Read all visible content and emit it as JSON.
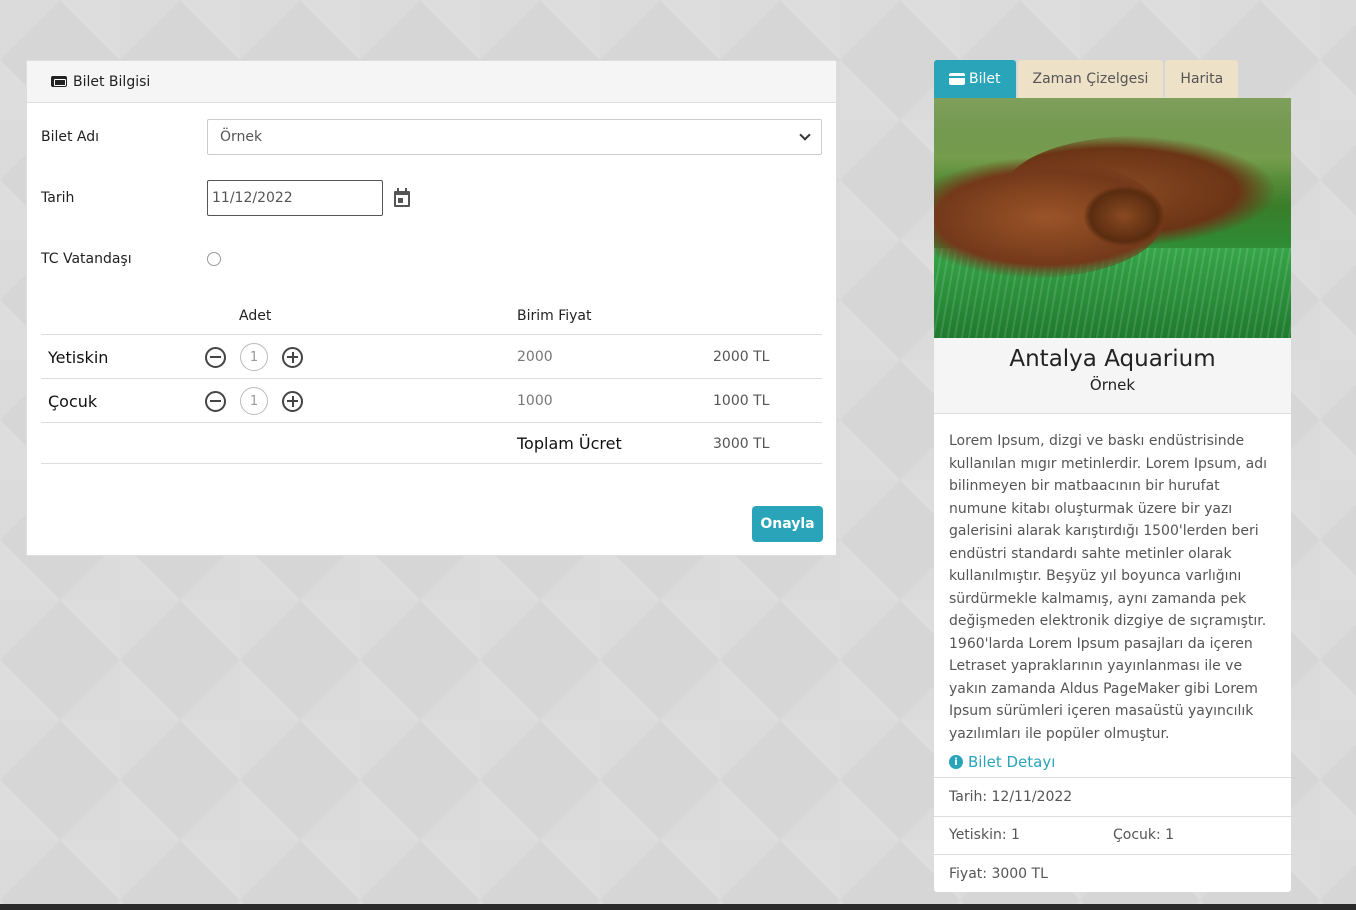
{
  "form": {
    "header_title": "Bilet Bilgisi",
    "ticket_name_label": "Bilet Adı",
    "ticket_name_value": "Örnek",
    "date_label": "Tarih",
    "date_value": "11/12/2022",
    "citizen_label": "TC Vatandaşı",
    "table": {
      "col_qty": "Adet",
      "col_unit_price": "Birim Fiyat",
      "rows": [
        {
          "label": "Yetiskin",
          "qty": "1",
          "unit_price": "2000",
          "total": "2000 TL"
        },
        {
          "label": "Çocuk",
          "qty": "1",
          "unit_price": "1000",
          "total": "1000 TL"
        }
      ],
      "total_label": "Toplam Ücret",
      "total_value": "3000 TL"
    },
    "confirm_label": "Onayla"
  },
  "tabs": [
    {
      "label": "Bilet",
      "active": true
    },
    {
      "label": "Zaman Çizelgesi",
      "active": false
    },
    {
      "label": "Harita",
      "active": false
    }
  ],
  "summary": {
    "title": "Antalya Aquarium",
    "subtitle": "Örnek",
    "description": "Lorem Ipsum, dizgi ve baskı endüstrisinde kullanılan mıgır metinlerdir. Lorem Ipsum, adı bilinmeyen bir matbaacının bir hurufat numune kitabı oluşturmak üzere bir yazı galerisini alarak karıştırdığı 1500'lerden beri endüstri standardı sahte metinler olarak kullanılmıştır. Beşyüz yıl boyunca varlığını sürdürmekle kalmamış, aynı zamanda pek değişmeden elektronik dizgiye de sıçramıştır. 1960'larda Lorem Ipsum pasajları da içeren Letraset yapraklarının yayınlanması ile ve yakın zamanda Aldus PageMaker gibi Lorem Ipsum sürümleri içeren masaüstü yayıncılık yazılımları ile popüler olmuştur.",
    "detail_link": "Bilet Detayı",
    "date_line": "Tarih: 12/11/2022",
    "adult_line": "Yetiskin: 1",
    "child_line": "Çocuk: 1",
    "price_line": "Fiyat: 3000 TL"
  },
  "colors": {
    "accent": "#2aa4b9",
    "tab_inactive": "#ede1c8"
  },
  "icons": [
    "ticket-icon",
    "chevron-down-icon",
    "calendar-icon",
    "minus-circle-icon",
    "plus-circle-icon",
    "credit-card-icon",
    "info-icon"
  ]
}
